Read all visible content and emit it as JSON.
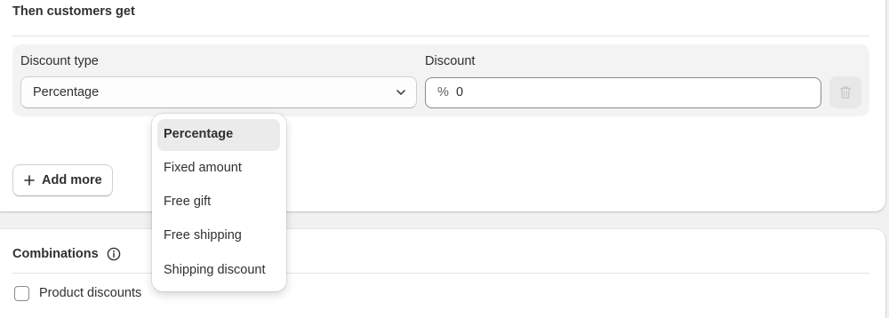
{
  "section": {
    "title": "Then customers get"
  },
  "rule": {
    "discount_type_label": "Discount type",
    "discount_type_value": "Percentage",
    "discount_label": "Discount",
    "discount_prefix": "%",
    "discount_value": "0"
  },
  "actions": {
    "add_more_label": "Add more"
  },
  "combinations": {
    "title": "Combinations",
    "checkbox_label": "Product discounts"
  },
  "dropdown": {
    "options": [
      {
        "label": "Percentage",
        "selected": true
      },
      {
        "label": "Fixed amount",
        "selected": false
      },
      {
        "label": "Free gift",
        "selected": false
      },
      {
        "label": "Free shipping",
        "selected": false
      },
      {
        "label": "Shipping discount",
        "selected": false
      }
    ]
  },
  "icons": {
    "chevron": "chevron-down-icon",
    "delete": "trash-icon",
    "add": "plus-icon",
    "info": "info-icon"
  },
  "colors": {
    "page_bg": "#f1f1f1",
    "card_bg": "#ffffff",
    "rule_bg": "#f3f3f3",
    "text": "#303030",
    "selected_option_bg": "#ebebeb"
  }
}
